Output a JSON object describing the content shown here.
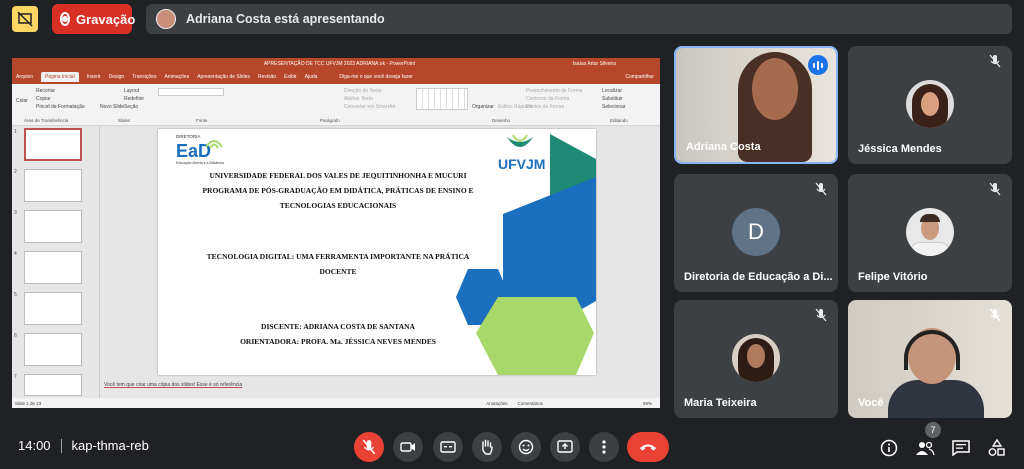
{
  "topbar": {
    "record_label": "Gravação",
    "presenting_text": "Adriana Costa está apresentando"
  },
  "ppt": {
    "title": "APRESENTAÇÃO DE TCC UFVJM 2023 ADRIANA.ok  -  PowerPoint",
    "user": "Isaías Artur Silveira",
    "tabs": [
      "Arquivo",
      "Página Inicial",
      "Inserir",
      "Design",
      "Transições",
      "Animações",
      "Apresentação de Slides",
      "Revisão",
      "Exibir",
      "Ajuda"
    ],
    "search": "Diga-me o que você deseja fazer",
    "share": "Compartilhar",
    "ribbon": {
      "paste": "Colar",
      "cut": "Recortar",
      "copy": "Copiar",
      "format_painter": "Pincel de Formatação",
      "clipboard": "Área de Transferência",
      "new_slide": "Novo Slide",
      "layout": "Layout",
      "reset": "Redefinir",
      "section": "Seção",
      "slides": "Slides",
      "font": "Fonte",
      "paragraph": "Parágrafo",
      "text_direction": "Direção do Texto",
      "align_text": "Alinhar Texto",
      "smartart": "Converter em SmartArt",
      "drawing": "Desenho",
      "arrange": "Organizar",
      "quick_styles": "Estilos Rápidos",
      "fill": "Preenchimento da Forma",
      "outline": "Contorno da Forma",
      "effects": "Efeitos de Forma",
      "find": "Localizar",
      "replace": "Substituir",
      "select": "Selecionar",
      "editing": "Editando"
    },
    "notes": "Você tem que criar uma cópia dos slides! Esse é só referência",
    "status_slide": "Slide 1 de 23",
    "status_notes": "Anotações",
    "status_comments": "Comentários",
    "zoom": "69%"
  },
  "slide": {
    "dir_label": "DIRETORIA",
    "ead": "EaD",
    "ead_sub": "Educação Aberta e a Distância",
    "ufvjm": "UFVJM",
    "header": [
      "UNIVERSIDADE FEDERAL DOS VALES DE JEQUITINHONHA E MUCURI",
      "PROGRAMA DE PÓS-GRADUAÇÃO EM DIDÁTICA, PRÁTICAS DE ENSINO E",
      "TECNOLOGIAS EDUCACIONAIS"
    ],
    "title": [
      "TECNOLOGIA DIGITAL: UMA FERRAMENTA IMPORTANTE NA PRÁTICA",
      "DOCENTE"
    ],
    "student": "DISCENTE: ADRIANA COSTA DE SANTANA",
    "advisor": "ORIENTADORA: PROFA. Ma. JÉSSICA NEVES MENDES"
  },
  "thumbs": [
    "1",
    "2",
    "3",
    "4",
    "5",
    "6",
    "7"
  ],
  "participants": [
    {
      "name": "Adriana Costa"
    },
    {
      "name": "Jéssica Mendes"
    },
    {
      "name": "Diretoria de Educação a Di...",
      "initial": "D"
    },
    {
      "name": "Felipe Vitório"
    },
    {
      "name": "Maria Teixeira"
    },
    {
      "name": "Você"
    }
  ],
  "bottombar": {
    "time": "14:00",
    "meeting_code": "kap-thma-reb",
    "people_count": "7"
  },
  "colors": {
    "bg": "#202124",
    "tile": "#3c4043",
    "red": "#ea4335",
    "ppt": "#b7472a",
    "slide_green": "#9dd35a",
    "slide_blue": "#1a6fbf",
    "slide_teal": "#1f8a74"
  }
}
